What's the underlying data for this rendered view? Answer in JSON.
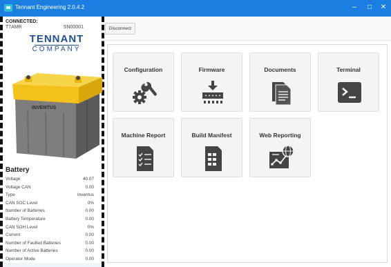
{
  "window": {
    "title": "Tennant Engineering 2.0.4.2",
    "minimize_glyph": "–",
    "maximize_glyph": "□",
    "close_glyph": "✕"
  },
  "connection": {
    "status_label": "CONNECTED:",
    "model": "T7AMR",
    "serial": "SN00001"
  },
  "logo": {
    "line1": "TENNANT",
    "line2": "COMPANY"
  },
  "battery_image": {
    "brand": "INVENTUS"
  },
  "toolbar": {
    "disconnect_label": "Disconnect"
  },
  "battery": {
    "title": "Battery",
    "rows": [
      {
        "label": "Voltage",
        "value": "40.07"
      },
      {
        "label": "Voltage CAN",
        "value": "0.00"
      },
      {
        "label": "Type",
        "value": "Inventus"
      },
      {
        "label": "CAN SOC Level",
        "value": "0%"
      },
      {
        "label": "Number of Batteries",
        "value": "0.00"
      },
      {
        "label": "Battery Temperature",
        "value": "0.00"
      },
      {
        "label": "CAN SOH Level",
        "value": "0%"
      },
      {
        "label": "Current",
        "value": "0.00"
      },
      {
        "label": "Number of Faulted Batteries",
        "value": "0.00"
      },
      {
        "label": "Number of Active Batteries",
        "value": "0.00"
      },
      {
        "label": "Operator Mode",
        "value": "0.00"
      }
    ]
  },
  "tiles": [
    {
      "label": "Configuration",
      "icon": "wrench-gear-icon"
    },
    {
      "label": "Firmware",
      "icon": "chip-download-icon"
    },
    {
      "label": "Documents",
      "icon": "documents-icon"
    },
    {
      "label": "Terminal",
      "icon": "terminal-icon"
    },
    {
      "label": "Machine Report",
      "icon": "checklist-icon"
    },
    {
      "label": "Build Manifest",
      "icon": "manifest-icon"
    },
    {
      "label": "Web Reporting",
      "icon": "web-chart-icon"
    }
  ],
  "colors": {
    "titlebar": "#1a7fe0",
    "brand_blue": "#1f4f8f",
    "icon_dark": "#444444",
    "battery_yellow": "#f2c21a"
  }
}
